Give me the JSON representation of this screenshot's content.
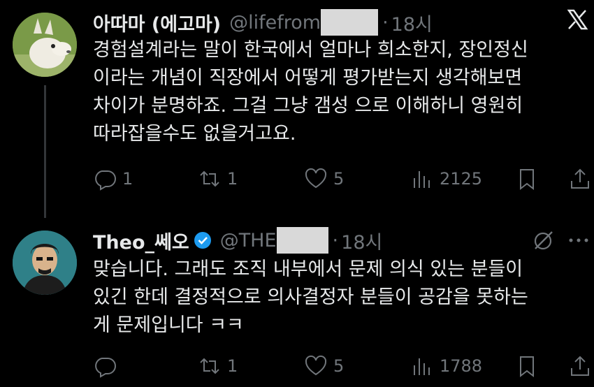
{
  "tweets": [
    {
      "display_name": "아따마 (에고마)",
      "handle": "@lifefrom",
      "time": "18시",
      "body_lines": [
        "경험설계라는 말이 한국에서 얼마나 희소한지, 장인정신",
        "이라는 개념이 직장에서 어떻게 평가받는지 생각해보면",
        "차이가 분명하죠. 그걸 그냥 갬성 으로 이해하니 영원히",
        "따라잡을수도 없을거고요."
      ],
      "replies": "1",
      "retweets": "1",
      "likes": "5",
      "views": "2125"
    },
    {
      "display_name": "Theo_쎄오",
      "handle": "@THE",
      "time": "18시",
      "body_lines": [
        "맞습니다. 그래도 조직 내부에서 문제 의식 있는 분들이",
        "있긴 한데 결정적으로 의사결정자 분들이 공감을 못하는",
        "게 문제입니다 ㅋㅋ"
      ],
      "replies": "",
      "retweets": "1",
      "likes": "5",
      "views": "1788"
    }
  ],
  "icons": {
    "x_logo": "x-logo-icon",
    "grok": "grok-icon",
    "more": "more-icon",
    "verified": "verified-badge-icon"
  },
  "colors": {
    "background": "#000000",
    "text": "#e7e9ea",
    "muted": "#71767b",
    "verified": "#1d9bf0",
    "redaction": "#d9d9d9"
  }
}
